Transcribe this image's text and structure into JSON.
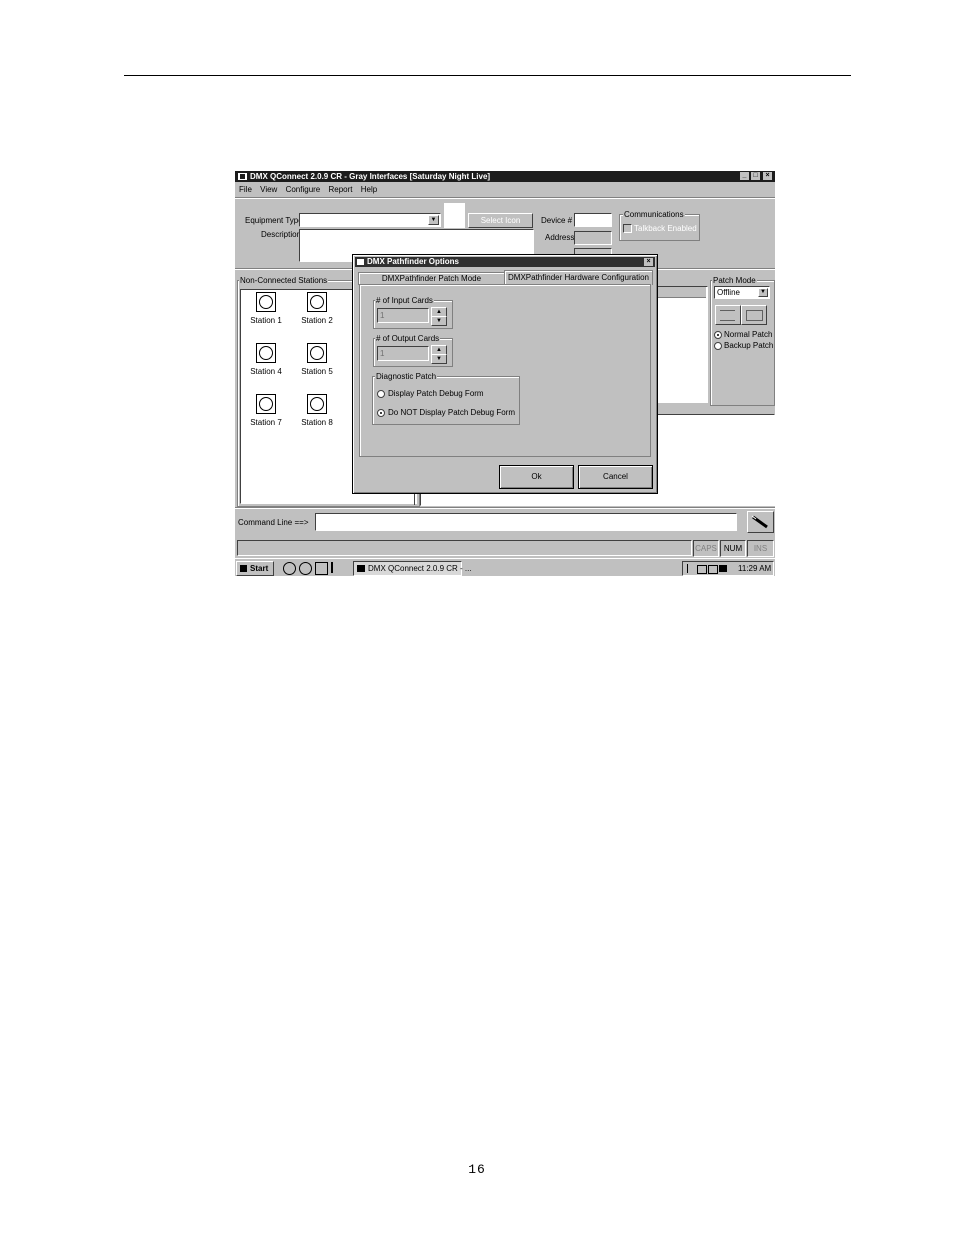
{
  "page": {
    "page_number": "16"
  },
  "window": {
    "title": "DMX QConnect 2.0.9 CR - Gray Interfaces [Saturday Night Live]",
    "controls": [
      "_",
      "□",
      "×"
    ]
  },
  "menu": [
    "File",
    "View",
    "Configure",
    "Report",
    "Help"
  ],
  "form": {
    "equipment_type_label": "Equipment Type",
    "description_label": "Description",
    "select_icon_button": "Select Icon",
    "device_label": "Device #",
    "address_label": "Address",
    "communications": {
      "title": "Communications",
      "talkback_label": "Talkback Enabled"
    }
  },
  "stations": {
    "title": "Non-Connected Stations",
    "items": [
      "Station 1",
      "Station 2",
      "Station 4",
      "Station 5",
      "Station 7",
      "Station 8"
    ]
  },
  "patch_mode": {
    "title": "Patch Mode",
    "select_value": "Offline",
    "options": [
      {
        "label": "Normal Patch",
        "selected": true
      },
      {
        "label": "Backup Patch",
        "selected": false
      }
    ]
  },
  "dialog": {
    "title": "DMX Pathfinder Options",
    "tabs": [
      "DMXPathfinder Patch Mode",
      "DMXPathfinder Hardware Configuration"
    ],
    "input_cards": {
      "label": "# of Input Cards",
      "value": "1"
    },
    "output_cards": {
      "label": "# of Output Cards",
      "value": "1"
    },
    "diagnostic": {
      "title": "Diagnostic Patch",
      "options": [
        {
          "label": "Display Patch Debug Form",
          "selected": false
        },
        {
          "label": "Do NOT Display Patch Debug Form",
          "selected": true
        }
      ]
    },
    "ok_label": "Ok",
    "cancel_label": "Cancel"
  },
  "command_line": {
    "label": "Command Line ==>",
    "value": ""
  },
  "status_bar": [
    "CAPS",
    "NUM",
    "INS"
  ],
  "taskbar": {
    "start_label": "Start",
    "app_label": "DMX QConnect 2.0.9 CR - ...",
    "clock": "11:29 AM"
  }
}
